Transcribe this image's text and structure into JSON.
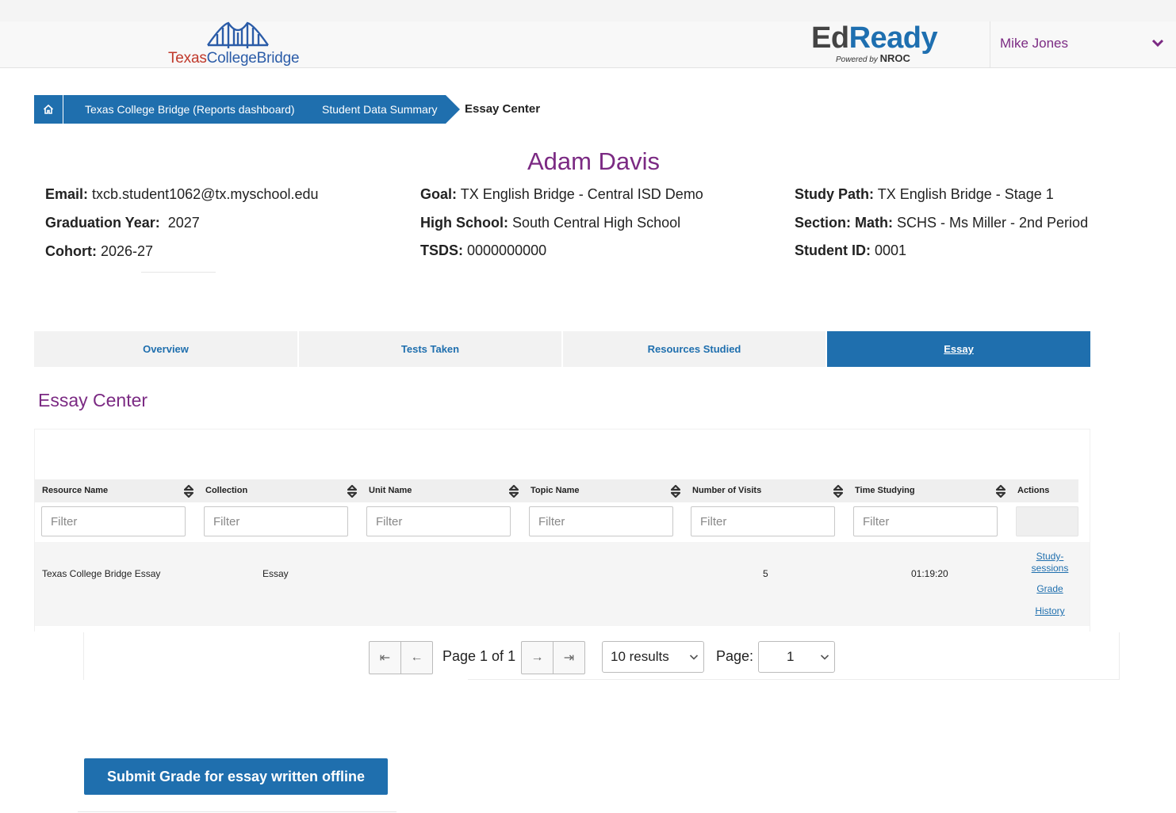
{
  "header": {
    "brand_part1": "Texas",
    "brand_part2": "CollegeBridge",
    "edready_ed": "Ed",
    "edready_ready": "Ready",
    "edready_powered": "Powered by ",
    "edready_nroc": "NROC",
    "user_name": "Mike Jones"
  },
  "breadcrumb": {
    "item1": "Texas College Bridge (Reports dashboard)",
    "item2": "Student Data Summary",
    "current": "Essay Center"
  },
  "student": {
    "name": "Adam Davis",
    "email_label": "Email:",
    "email": "txcb.student1062@tx.myschool.edu",
    "grad_label": "Graduation Year:",
    "grad": "2027",
    "cohort_label": "Cohort:",
    "cohort": "2026-27",
    "goal_label": "Goal:",
    "goal": "TX English Bridge - Central ISD Demo",
    "school_label": "High School:",
    "school": "South Central High School",
    "tsds_label": "TSDS:",
    "tsds": "0000000000",
    "path_label": "Study Path:",
    "path": "TX English Bridge - Stage 1",
    "section_label": "Section: Math:",
    "section": "SCHS - Ms Miller - 2nd Period",
    "id_label": "Student ID:",
    "id": "0001"
  },
  "tabs": [
    "Overview",
    "Tests Taken",
    "Resources Studied",
    "Essay"
  ],
  "section_title": "Essay Center",
  "table": {
    "columns": [
      "Resource Name",
      "Collection",
      "Unit Name",
      "Topic Name",
      "Number of Visits",
      "Time Studying",
      "Actions"
    ],
    "filter_placeholder": "Filter",
    "rows": [
      {
        "resource": "Texas College Bridge Essay",
        "collection": "Essay",
        "unit": "",
        "topic": "",
        "visits": "5",
        "time": "01:19:20",
        "actions": [
          "Study-sessions",
          "Grade",
          "History"
        ]
      }
    ]
  },
  "pager": {
    "first": "⇤",
    "prev": "←",
    "next": "→",
    "last": "⇥",
    "label": "Page 1 of 1",
    "results": "10 results",
    "page_word": "Page:",
    "page_value": "1"
  },
  "submit_label": "Submit Grade for essay written offline",
  "colors": {
    "primary": "#1f6fae",
    "accent": "#7b2a83"
  }
}
